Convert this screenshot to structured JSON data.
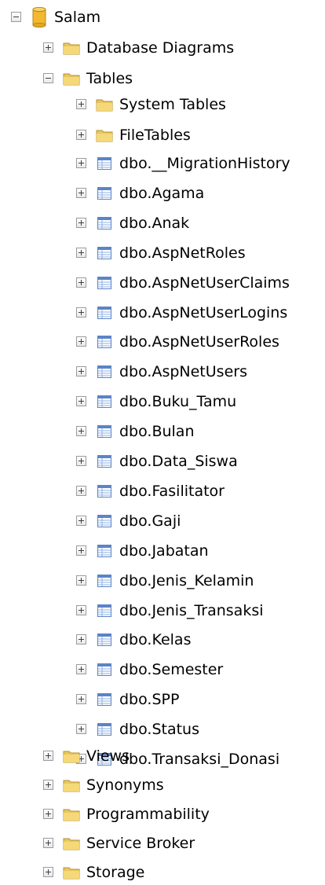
{
  "tree": {
    "root": {
      "label": "Salam",
      "icon": "database-icon",
      "expanded": true
    },
    "folders": [
      {
        "label": "Database Diagrams",
        "icon": "folder-icon",
        "expanded": false
      },
      {
        "label": "Tables",
        "icon": "folder-icon",
        "expanded": true
      },
      {
        "label": "System Tables",
        "icon": "folder-icon",
        "expanded": false
      },
      {
        "label": "FileTables",
        "icon": "folder-icon",
        "expanded": false
      }
    ],
    "tables": [
      "dbo.__MigrationHistory",
      "dbo.Agama",
      "dbo.Anak",
      "dbo.AspNetRoles",
      "dbo.AspNetUserClaims",
      "dbo.AspNetUserLogins",
      "dbo.AspNetUserRoles",
      "dbo.AspNetUsers",
      "dbo.Buku_Tamu",
      "dbo.Bulan",
      "dbo.Data_Siswa",
      "dbo.Fasilitator",
      "dbo.Gaji",
      "dbo.Jabatan",
      "dbo.Jenis_Kelamin",
      "dbo.Jenis_Transaksi",
      "dbo.Kelas",
      "dbo.Semester",
      "dbo.SPP",
      "dbo.Status",
      "dbo.Transaksi_Donasi"
    ],
    "table_icon": "table-icon",
    "bottom_folders": [
      {
        "label": "Views",
        "icon": "folder-icon",
        "expanded": false
      },
      {
        "label": "Synonyms",
        "icon": "folder-icon",
        "expanded": false
      },
      {
        "label": "Programmability",
        "icon": "folder-icon",
        "expanded": false
      },
      {
        "label": "Service Broker",
        "icon": "folder-icon",
        "expanded": false
      },
      {
        "label": "Storage",
        "icon": "folder-icon",
        "expanded": false
      }
    ]
  },
  "colors": {
    "text": "#000000",
    "folder": "#e8c75f",
    "database": "#f2b930",
    "table": "#5b84c8"
  }
}
